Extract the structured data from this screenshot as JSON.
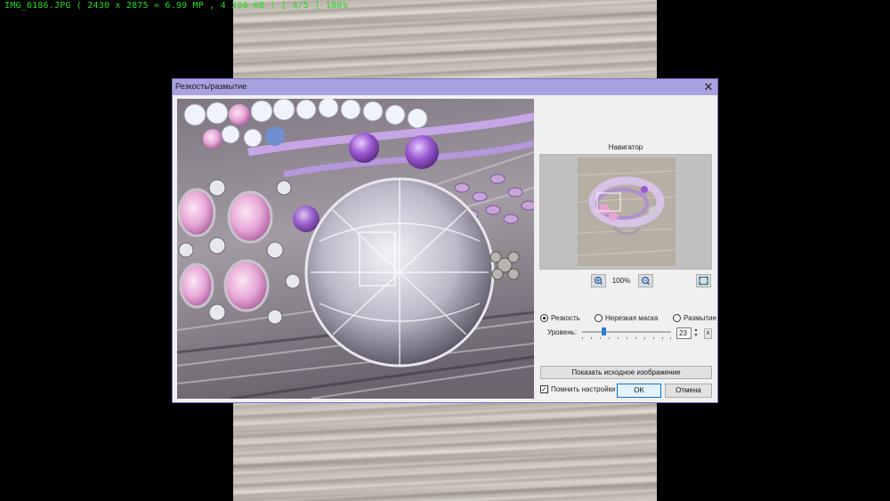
{
  "viewer": {
    "info_line": "IMG_6186.JPG ( 2430 x 2875 = 6.99 MP , 4 398 KB ) [ 4/5 ] 100%"
  },
  "dialog": {
    "title": "Резкость/размытие",
    "close_label": "✕",
    "navigator": {
      "title": "Навигатор",
      "zoom_level": "100%"
    },
    "modes": [
      {
        "label": "Резкость",
        "checked": true
      },
      {
        "label": "Нерезкая маска",
        "checked": false
      },
      {
        "label": "Размытие",
        "checked": false
      }
    ],
    "level": {
      "label": "Уровень:",
      "value": "23",
      "slider_fraction": 0.23,
      "reset_label": "x"
    },
    "show_original_label": "Показать исходное изображение",
    "remember_label": "Помнить настройки",
    "remember_checked": true,
    "ok_label": "OK",
    "cancel_label": "Отмена"
  },
  "colors": {
    "title_bar": "#a9a2e0",
    "accent": "#0078d7",
    "info_text": "#22dd22"
  },
  "icons": {
    "zoom_in": "zoom-in-icon",
    "zoom_out": "zoom-out-icon",
    "fit": "fit-to-window-icon",
    "close": "close-icon"
  }
}
